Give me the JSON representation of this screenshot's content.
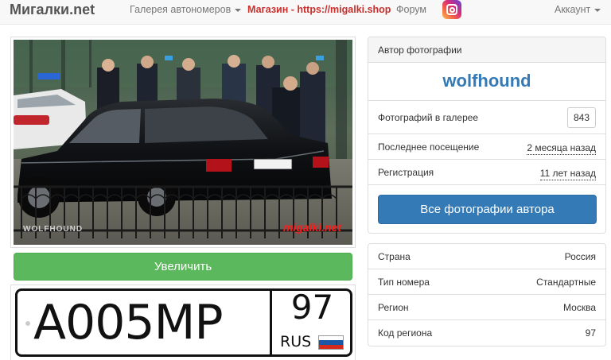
{
  "navbar": {
    "brand": "Мигалки.net",
    "gallery_label": "Галерея автономеров",
    "shop_label": "Магазин - https://migalki.shop",
    "forum_label": "Форум",
    "instagram_icon": "instagram-icon",
    "account_label": "Аккаунт"
  },
  "photo": {
    "watermark_left": "WOLFHOUND",
    "watermark_right": "migalki.net",
    "plate_text": "А005МР 97"
  },
  "zoom_button": "Увеличить",
  "plate": {
    "number": "А005МР",
    "region": "97",
    "country": "RUS",
    "flag_colors": [
      "#ffffff",
      "#1c57a5",
      "#d52b1e"
    ]
  },
  "author_panel": {
    "heading": "Автор фотографии",
    "author_name": "wolfhound",
    "photos_label": "Фотографий в галерее",
    "photos_count": "843",
    "last_visit_label": "Последнее посещение",
    "last_visit_value": "2 месяца назад",
    "registration_label": "Регистрация",
    "registration_value": "11 лет назад",
    "all_photos_button": "Все фотографии автора"
  },
  "info_panel": {
    "rows": [
      {
        "label": "Страна",
        "value": "Россия"
      },
      {
        "label": "Тип номера",
        "value": "Стандартные"
      },
      {
        "label": "Регион",
        "value": "Москва"
      },
      {
        "label": "Код региона",
        "value": "97"
      }
    ]
  },
  "colors": {
    "link_blue": "#337ab7",
    "success_green": "#5cb85c",
    "shop_red": "#c9302c"
  }
}
